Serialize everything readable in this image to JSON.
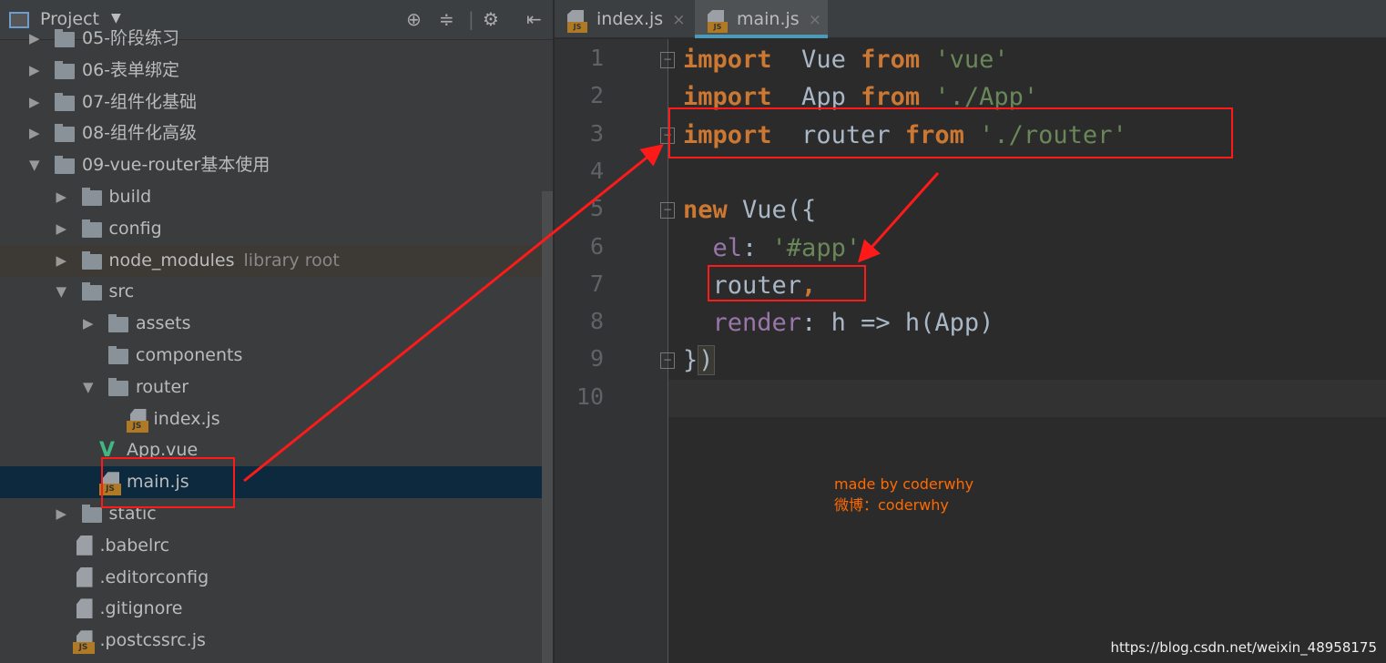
{
  "sidebar": {
    "title": "Project",
    "toolbar_icons": [
      "locate-icon",
      "collapse-icon",
      "gear-icon",
      "hide-icon"
    ],
    "items": [
      {
        "label": "05-阶段练习",
        "level": 0,
        "type": "folder",
        "arrow": "right"
      },
      {
        "label": "06-表单绑定",
        "level": 0,
        "type": "folder",
        "arrow": "right"
      },
      {
        "label": "07-组件化基础",
        "level": 0,
        "type": "folder",
        "arrow": "right"
      },
      {
        "label": "08-组件化高级",
        "level": 0,
        "type": "folder",
        "arrow": "right"
      },
      {
        "label": "09-vue-router基本使用",
        "level": 0,
        "type": "folder",
        "arrow": "down"
      },
      {
        "label": "build",
        "level": 1,
        "type": "folder",
        "arrow": "right"
      },
      {
        "label": "config",
        "level": 1,
        "type": "folder",
        "arrow": "right"
      },
      {
        "label": "node_modules",
        "extra": "library root",
        "level": 1,
        "type": "folder",
        "arrow": "right",
        "lib": true
      },
      {
        "label": "src",
        "level": 1,
        "type": "folder",
        "arrow": "down"
      },
      {
        "label": "assets",
        "level": 2,
        "type": "folder",
        "arrow": "right"
      },
      {
        "label": "components",
        "level": 2,
        "type": "folder"
      },
      {
        "label": "router",
        "level": 2,
        "type": "folder",
        "arrow": "down"
      },
      {
        "label": "index.js",
        "level": 3,
        "type": "js"
      },
      {
        "label": "App.vue",
        "level": 2,
        "type": "vue"
      },
      {
        "label": "main.js",
        "level": 2,
        "type": "js",
        "selected": true
      },
      {
        "label": "static",
        "level": 1,
        "type": "folder",
        "arrow": "right"
      },
      {
        "label": ".babelrc",
        "level": 1,
        "type": "json"
      },
      {
        "label": ".editorconfig",
        "level": 1,
        "type": "text"
      },
      {
        "label": ".gitignore",
        "level": 1,
        "type": "text"
      },
      {
        "label": ".postcssrc.js",
        "level": 1,
        "type": "js"
      }
    ]
  },
  "tabs": [
    {
      "label": "index.js",
      "active": false
    },
    {
      "label": "main.js",
      "active": true
    }
  ],
  "editor": {
    "line_numbers": [
      "1",
      "2",
      "3",
      "4",
      "5",
      "6",
      "7",
      "8",
      "9",
      "10"
    ],
    "lines": [
      [
        [
          "kw",
          "import"
        ],
        [
          "",
          "  Vue "
        ],
        [
          "kw",
          "from"
        ],
        [
          "str",
          " 'vue'"
        ]
      ],
      [
        [
          "kw",
          "import"
        ],
        [
          "",
          "  App "
        ],
        [
          "kw",
          "from"
        ],
        [
          "str",
          " './App'"
        ]
      ],
      [
        [
          "kw",
          "import"
        ],
        [
          "",
          "  router "
        ],
        [
          "kw",
          "from"
        ],
        [
          "str",
          " './router'"
        ]
      ],
      [],
      [
        [
          "kw",
          "new"
        ],
        [
          "",
          " Vue({"
        ]
      ],
      [
        [
          "",
          "  "
        ],
        [
          "prop",
          "el"
        ],
        [
          "",
          ": "
        ],
        [
          "str",
          "'#app'"
        ],
        [
          "kw",
          ","
        ]
      ],
      [
        [
          "",
          "  router"
        ],
        [
          "kw",
          ","
        ]
      ],
      [
        [
          "",
          "  "
        ],
        [
          "prop",
          "render"
        ],
        [
          "",
          ": h => h(App)"
        ]
      ],
      [
        [
          "",
          "})"
        ]
      ],
      []
    ],
    "current_line": "10"
  },
  "watermark": {
    "line1": "made by coderwhy",
    "line2": "微博：coderwhy"
  },
  "url": "https://blog.csdn.net/weixin_48958175",
  "colors": {
    "keyword": "#cc7832",
    "string": "#6a8759",
    "property": "#9876aa",
    "annotation": "#ff1a1a",
    "selection": "#0d293e"
  }
}
